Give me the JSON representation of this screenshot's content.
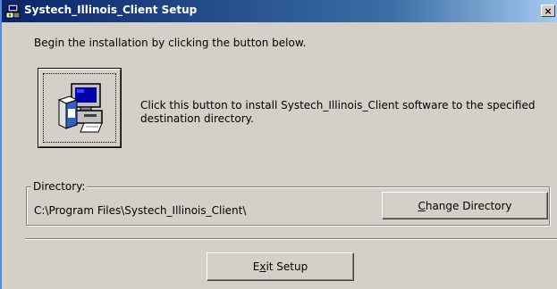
{
  "window": {
    "title": "Systech_Illinois_Client Setup",
    "close_label": "×"
  },
  "intro_text": "Begin the installation by clicking the button below.",
  "install": {
    "icon": "computer-install-icon",
    "description": "Click this button to install Systech_Illinois_Client software to the specified destination directory."
  },
  "directory": {
    "legend": "Directory:",
    "path": "C:\\Program Files\\Systech_Illinois_Client\\",
    "change_button": {
      "mnemonic": "C",
      "rest": "hange Directory"
    }
  },
  "exit_button": {
    "before": "E",
    "mnemonic": "x",
    "after": "it Setup"
  },
  "colors": {
    "title_gradient_start": "#0a246a",
    "title_gradient_end": "#a6caf0",
    "face": "#d4d0c8"
  }
}
